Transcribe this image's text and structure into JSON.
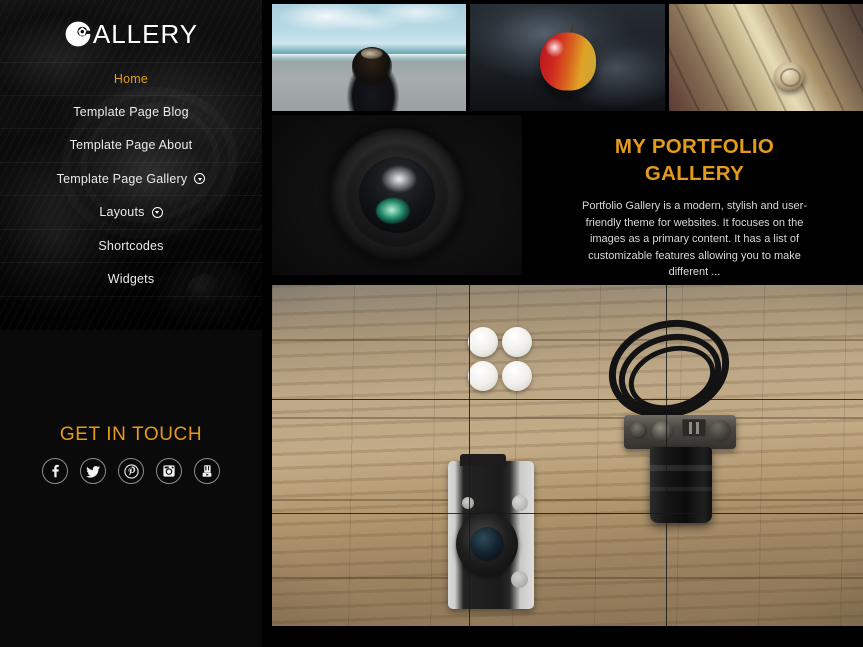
{
  "site": {
    "logo_mark": "aperture-icon",
    "logo_initial": "G",
    "logo_text": "ALLERY"
  },
  "sidebar": {
    "nav": [
      {
        "label": "Home",
        "active": true,
        "has_submenu": false,
        "name": "sidebar-item-home"
      },
      {
        "label": "Template Page Blog",
        "active": false,
        "has_submenu": false,
        "name": "sidebar-item-template-page-blog"
      },
      {
        "label": "Template Page About",
        "active": false,
        "has_submenu": false,
        "name": "sidebar-item-template-page-about"
      },
      {
        "label": "Template Page Gallery",
        "active": false,
        "has_submenu": true,
        "name": "sidebar-item-template-page-gallery"
      },
      {
        "label": "Layouts",
        "active": false,
        "has_submenu": true,
        "name": "sidebar-item-layouts"
      },
      {
        "label": "Shortcodes",
        "active": false,
        "has_submenu": false,
        "name": "sidebar-item-shortcodes"
      },
      {
        "label": "Widgets",
        "active": false,
        "has_submenu": false,
        "name": "sidebar-item-widgets"
      }
    ],
    "get_in_touch": {
      "title": "GET IN TOUCH",
      "socials": [
        {
          "name": "facebook-icon",
          "label": "Facebook"
        },
        {
          "name": "twitter-icon",
          "label": "Twitter"
        },
        {
          "name": "pinterest-icon",
          "label": "Pinterest"
        },
        {
          "name": "instagram-icon",
          "label": "Instagram"
        },
        {
          "name": "youtube-icon",
          "label": "YouTube"
        }
      ]
    }
  },
  "main": {
    "top_thumbnails": [
      {
        "name": "thumbnail-beach",
        "alt": "Girl with flower crown looking at the ocean"
      },
      {
        "name": "thumbnail-apple",
        "alt": "Red apple on a dark smoky background"
      },
      {
        "name": "thumbnail-snail",
        "alt": "Snail shell on a wooden boardwalk"
      }
    ],
    "lens_panel": {
      "name": "camera-lens-image",
      "alt": "Front view of a camera lens with green flare"
    },
    "portfolio": {
      "title_line1": "MY PORTFOLIO",
      "title_line2": "GALLERY",
      "description": "Portfolio Gallery is a modern, stylish and user-friendly theme for websites. It focuses on the images as a primary content. It has a list of customizable features allowing you to make different ..."
    },
    "hero": {
      "name": "hero-cameras-image",
      "alt": "Two cameras and film canisters on a wooden table with rule-of-thirds grid"
    }
  },
  "colors": {
    "accent": "#e49b1b",
    "background": "#000000",
    "text": "#ebebeb"
  }
}
